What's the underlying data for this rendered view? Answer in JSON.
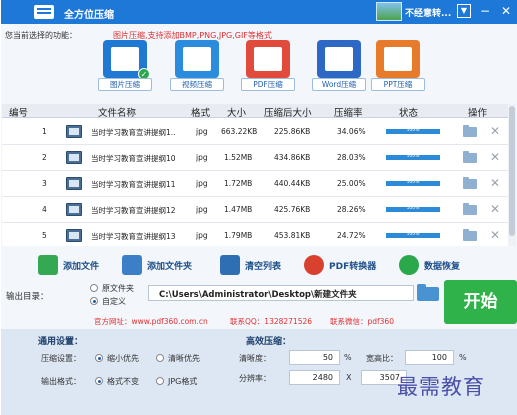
{
  "app": {
    "title": "全方位压缩",
    "notice": "不经意转..."
  },
  "functions": {
    "label": "您当前选择的功能：",
    "hint": "图片压缩,支持添加BMP,PNG,JPG,GIF等格式",
    "items": [
      {
        "label": "图片压缩",
        "color": "#1f79d2",
        "icon": "image-compress-icon"
      },
      {
        "label": "视频压缩",
        "color": "#2b8bdc",
        "icon": "video-compress-icon"
      },
      {
        "label": "PDF压缩",
        "color": "#e04b3c",
        "icon": "pdf-compress-icon"
      },
      {
        "label": "Word压缩",
        "color": "#2d68c4",
        "icon": "word-compress-icon"
      },
      {
        "label": "PPT压缩",
        "color": "#e87a2c",
        "icon": "ppt-compress-icon"
      }
    ]
  },
  "table": {
    "headers": [
      "编号",
      "文件名称",
      "格式",
      "大小",
      "压缩后大小",
      "压缩率",
      "状态",
      "操作"
    ],
    "rows": [
      {
        "no": "1",
        "name": "当时学习教育宣讲提纲1..",
        "format": "jpg",
        "size": "663.22KB",
        "after": "225.86KB",
        "rate": "34.06%",
        "status": "100%"
      },
      {
        "no": "2",
        "name": "当时学习教育宣讲提纲10",
        "format": "jpg",
        "size": "1.52MB",
        "after": "434.86KB",
        "rate": "28.03%",
        "status": "100%"
      },
      {
        "no": "3",
        "name": "当时学习教育宣讲提纲11",
        "format": "jpg",
        "size": "1.72MB",
        "after": "440.44KB",
        "rate": "25.00%",
        "status": "100%"
      },
      {
        "no": "4",
        "name": "当时学习教育宣讲提纲12",
        "format": "jpg",
        "size": "1.47MB",
        "after": "425.76KB",
        "rate": "28.26%",
        "status": "100%"
      },
      {
        "no": "5",
        "name": "当时学习教育宣讲提纲13",
        "format": "jpg",
        "size": "1.79MB",
        "after": "453.81KB",
        "rate": "24.72%",
        "status": "100%"
      }
    ],
    "progress": 1.0
  },
  "toolbar": {
    "add_file": "添加文件",
    "add_folder": "添加文件夹",
    "clear_list": "清空列表",
    "pdf_converter": "PDF转换器",
    "data_recovery": "数据恢复"
  },
  "output": {
    "label": "输出目录：",
    "option_source": "原文件夹",
    "option_custom": "自定义",
    "path": "C:\\Users\\Administrator\\Desktop\\新建文件夹",
    "start": "开始"
  },
  "links": {
    "website": "官方网址：www.pdf360.com.cn",
    "qq": "联系QQ：1328271526",
    "wechat": "联系微信：pdf360"
  },
  "general": {
    "title": "通用设置：",
    "compress_label": "压缩设置：",
    "opt_small": "缩小优先",
    "opt_clear": "清晰优先",
    "format_label": "输出格式：",
    "opt_keep": "格式不变",
    "opt_jpg": "JPG格式"
  },
  "advanced": {
    "title": "高效压缩：",
    "clarity_label": "清晰度：",
    "clarity": "50",
    "clarity_unit": "%",
    "ratio_label": "宽高比：",
    "ratio": "100",
    "ratio_unit": "%",
    "resolution_label": "分辨率：",
    "width": "2480",
    "times": "X",
    "height": "3507"
  },
  "watermark": "最需教育"
}
